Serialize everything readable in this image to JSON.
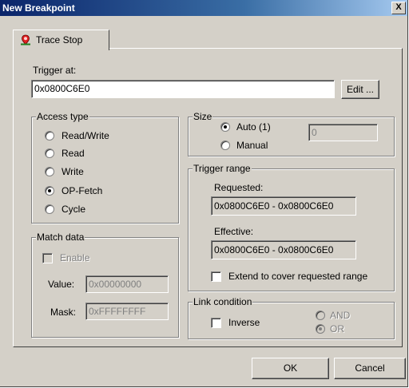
{
  "window": {
    "title": "New Breakpoint",
    "close_glyph": "X"
  },
  "tab": {
    "label": "Trace Stop",
    "icon": "breakpoint-icon"
  },
  "trigger": {
    "label": "Trigger at:",
    "value": "0x0800C6E0",
    "edit_label": "Edit ..."
  },
  "access_type": {
    "title": "Access type",
    "options": [
      "Read/Write",
      "Read",
      "Write",
      "OP-Fetch",
      "Cycle"
    ],
    "selected": "OP-Fetch"
  },
  "size": {
    "title": "Size",
    "auto_label": "Auto (1)",
    "manual_label": "Manual",
    "selected": "Auto (1)",
    "manual_value": "0"
  },
  "trigger_range": {
    "title": "Trigger range",
    "requested_label": "Requested:",
    "requested_value": "0x0800C6E0 - 0x0800C6E0",
    "effective_label": "Effective:",
    "effective_value": "0x0800C6E0 - 0x0800C6E0",
    "extend_label": "Extend to cover requested range",
    "extend_checked": false
  },
  "match_data": {
    "title": "Match data",
    "enable_label": "Enable",
    "value_label": "Value:",
    "value": "0x00000000",
    "mask_label": "Mask:",
    "mask": "0xFFFFFFFF"
  },
  "link_condition": {
    "title": "Link condition",
    "inverse_label": "Inverse",
    "and_label": "AND",
    "or_label": "OR",
    "selected": "OR"
  },
  "buttons": {
    "ok": "OK",
    "cancel": "Cancel"
  },
  "colors": {
    "face": "#d4d0c8",
    "title_start": "#0a246a",
    "title_end": "#a6caf0",
    "disabled_text": "#808080"
  }
}
